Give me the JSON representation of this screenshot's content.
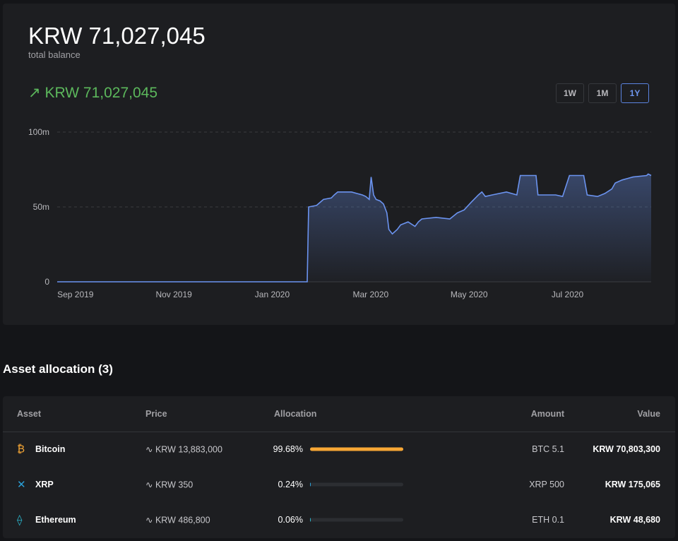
{
  "balance": {
    "amount": "KRW 71,027,045",
    "label": "total balance",
    "change": "KRW 71,027,045",
    "change_icon": "arrow-up-right-icon"
  },
  "ranges": [
    "1W",
    "1M",
    "1Y"
  ],
  "active_range": "1Y",
  "chart_data": {
    "type": "area",
    "title": "",
    "xlabel": "",
    "ylabel": "",
    "x_unit": "months since Sep 2019",
    "xlim": [
      -0.37,
      11.7
    ],
    "ylim": [
      0,
      100
    ],
    "y_unit": "millions KRW",
    "yticks": [
      {
        "v": 0,
        "label": "0"
      },
      {
        "v": 50,
        "label": "50m"
      },
      {
        "v": 100,
        "label": "100m"
      }
    ],
    "xticks": [
      {
        "v": 0,
        "label": "Sep 2019"
      },
      {
        "v": 2,
        "label": "Nov 2019"
      },
      {
        "v": 4,
        "label": "Jan 2020"
      },
      {
        "v": 6,
        "label": "Mar 2020"
      },
      {
        "v": 8,
        "label": "May 2020"
      },
      {
        "v": 10,
        "label": "Jul 2020"
      }
    ],
    "grid": "horizontal-dashed",
    "color": "#6b93ef",
    "points": [
      [
        -0.37,
        0
      ],
      [
        4.71,
        0
      ],
      [
        4.74,
        50
      ],
      [
        4.9,
        51
      ],
      [
        4.97,
        53
      ],
      [
        5.04,
        55
      ],
      [
        5.2,
        56
      ],
      [
        5.26,
        58
      ],
      [
        5.33,
        60
      ],
      [
        5.61,
        60
      ],
      [
        5.83,
        58
      ],
      [
        5.9,
        57
      ],
      [
        5.97,
        55
      ],
      [
        6.01,
        70
      ],
      [
        6.06,
        58
      ],
      [
        6.11,
        55
      ],
      [
        6.19,
        54
      ],
      [
        6.26,
        52
      ],
      [
        6.33,
        46
      ],
      [
        6.37,
        35
      ],
      [
        6.44,
        32
      ],
      [
        6.54,
        35
      ],
      [
        6.61,
        38
      ],
      [
        6.76,
        40
      ],
      [
        6.9,
        37
      ],
      [
        6.97,
        40
      ],
      [
        7.04,
        42
      ],
      [
        7.33,
        43
      ],
      [
        7.61,
        42
      ],
      [
        7.76,
        46
      ],
      [
        7.9,
        48
      ],
      [
        8.04,
        53
      ],
      [
        8.19,
        58
      ],
      [
        8.26,
        60
      ],
      [
        8.33,
        57
      ],
      [
        8.47,
        58
      ],
      [
        8.76,
        60
      ],
      [
        8.97,
        58
      ],
      [
        9.04,
        71
      ],
      [
        9.36,
        71
      ],
      [
        9.4,
        58
      ],
      [
        9.76,
        58
      ],
      [
        9.9,
        57
      ],
      [
        10.04,
        71
      ],
      [
        10.33,
        71
      ],
      [
        10.4,
        58
      ],
      [
        10.61,
        57
      ],
      [
        10.76,
        59
      ],
      [
        10.9,
        62
      ],
      [
        10.97,
        66
      ],
      [
        11.11,
        68
      ],
      [
        11.33,
        70
      ],
      [
        11.61,
        71
      ],
      [
        11.64,
        72
      ],
      [
        11.7,
        71
      ]
    ]
  },
  "allocation": {
    "title": "Asset allocation (3)",
    "headers": {
      "asset": "Asset",
      "price": "Price",
      "allocation": "Allocation",
      "amount": "Amount",
      "value": "Value"
    },
    "rows": [
      {
        "icon": "bitcoin-icon",
        "name": "Bitcoin",
        "price": "KRW 13,883,000",
        "pct": "99.68%",
        "fraction": 0.9968,
        "color": "#f7a735",
        "amount": "BTC 5.1",
        "value": "KRW 70,803,300"
      },
      {
        "icon": "xrp-icon",
        "name": "XRP",
        "price": "KRW 350",
        "pct": "0.24%",
        "fraction": 0.0024,
        "color": "#2a9fd6",
        "amount": "XRP 500",
        "value": "KRW 175,065"
      },
      {
        "icon": "ethereum-icon",
        "name": "Ethereum",
        "price": "KRW 486,800",
        "pct": "0.06%",
        "fraction": 0.0006,
        "color": "#2ab0c6",
        "amount": "ETH 0.1",
        "value": "KRW 48,680"
      }
    ]
  }
}
